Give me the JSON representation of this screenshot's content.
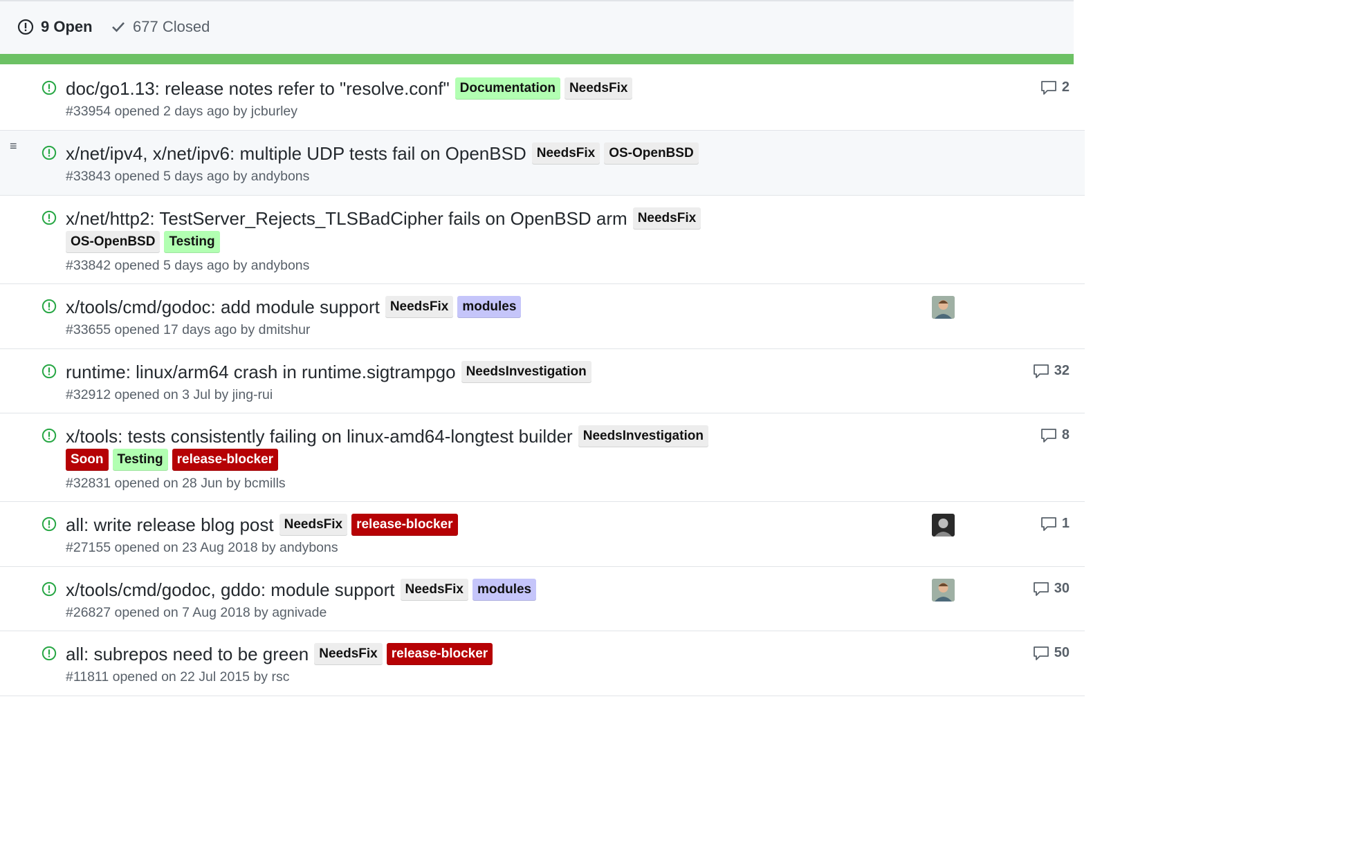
{
  "header": {
    "open_label": "9 Open",
    "closed_label": "677 Closed"
  },
  "progress": {
    "fraction_open": 0.013
  },
  "colors": {
    "gray": "#ededed",
    "green": "#b2ffb2",
    "purple": "#c5c5fa",
    "red": "#b60205",
    "open_icon": "#28a745"
  },
  "issues": [
    {
      "title": "doc/go1.13: release notes refer to \"resolve.conf\"",
      "labels": [
        {
          "text": "Documentation",
          "style": "green"
        },
        {
          "text": "NeedsFix",
          "style": "gray"
        }
      ],
      "meta": "#33954 opened 2 days ago by jcburley",
      "comments": "2",
      "avatar": null
    },
    {
      "title": "x/net/ipv4, x/net/ipv6: multiple UDP tests fail on OpenBSD",
      "labels": [
        {
          "text": "NeedsFix",
          "style": "gray"
        },
        {
          "text": "OS-OpenBSD",
          "style": "gray"
        }
      ],
      "meta": "#33843 opened 5 days ago by andybons",
      "comments": "",
      "avatar": null
    },
    {
      "title": "x/net/http2: TestServer_Rejects_TLSBadCipher fails on OpenBSD arm",
      "labels": [
        {
          "text": "NeedsFix",
          "style": "gray"
        }
      ],
      "labels2": [
        {
          "text": "OS-OpenBSD",
          "style": "gray"
        },
        {
          "text": "Testing",
          "style": "green"
        }
      ],
      "meta": "#33842 opened 5 days ago by andybons",
      "comments": "",
      "avatar": null
    },
    {
      "title": "x/tools/cmd/godoc: add module support",
      "labels": [
        {
          "text": "NeedsFix",
          "style": "gray"
        },
        {
          "text": "modules",
          "style": "purple"
        }
      ],
      "meta": "#33655 opened 17 days ago by dmitshur",
      "comments": "",
      "avatar": "light"
    },
    {
      "title": "runtime: linux/arm64 crash in runtime.sigtrampgo",
      "labels": [
        {
          "text": "NeedsInvestigation",
          "style": "gray"
        }
      ],
      "meta": "#32912 opened on 3 Jul by jing-rui",
      "comments": "32",
      "avatar": null
    },
    {
      "title": "x/tools: tests consistently failing on linux-amd64-longtest builder",
      "labels": [
        {
          "text": "NeedsInvestigation",
          "style": "gray"
        }
      ],
      "labels2": [
        {
          "text": "Soon",
          "style": "red"
        },
        {
          "text": "Testing",
          "style": "green"
        },
        {
          "text": "release-blocker",
          "style": "red"
        }
      ],
      "meta": "#32831 opened on 28 Jun by bcmills",
      "comments": "8",
      "avatar": null
    },
    {
      "title": "all: write release blog post",
      "labels": [
        {
          "text": "NeedsFix",
          "style": "gray"
        },
        {
          "text": "release-blocker",
          "style": "red"
        }
      ],
      "meta": "#27155 opened on 23 Aug 2018 by andybons",
      "comments": "1",
      "avatar": "dark"
    },
    {
      "title": "x/tools/cmd/godoc, gddo: module support",
      "labels": [
        {
          "text": "NeedsFix",
          "style": "gray"
        },
        {
          "text": "modules",
          "style": "purple"
        }
      ],
      "meta": "#26827 opened on 7 Aug 2018 by agnivade",
      "comments": "30",
      "avatar": "light"
    },
    {
      "title": "all: subrepos need to be green",
      "labels": [
        {
          "text": "NeedsFix",
          "style": "gray"
        },
        {
          "text": "release-blocker",
          "style": "red"
        }
      ],
      "meta": "#11811 opened on 22 Jul 2015 by rsc",
      "comments": "50",
      "avatar": null
    }
  ]
}
